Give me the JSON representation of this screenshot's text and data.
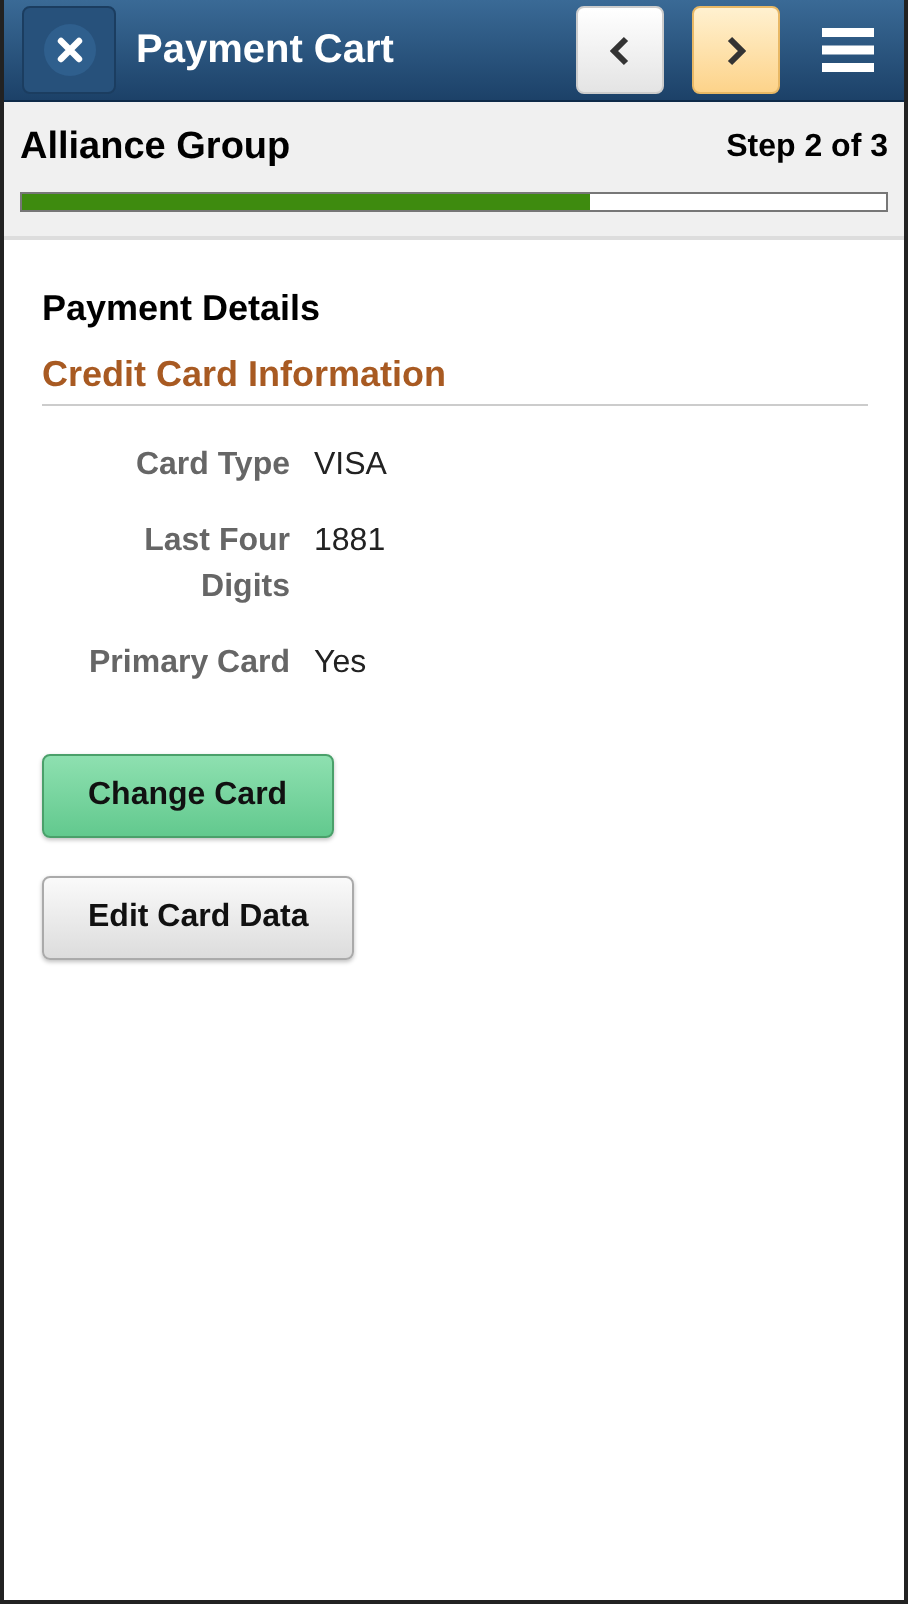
{
  "header": {
    "title": "Payment Cart",
    "nav_buttons": [
      {
        "kind": "previous",
        "highlighted": false
      },
      {
        "kind": "next",
        "highlighted": true
      }
    ]
  },
  "progress": {
    "name": "Alliance Group",
    "step": "Step 2 of 3",
    "level": 0.657
  },
  "section": {
    "title": "Payment Details",
    "group_title": "Credit Card Information",
    "fields": [
      {
        "label": "Card Type",
        "value": "VISA"
      },
      {
        "label": "Last Four Digits",
        "value": "1881"
      },
      {
        "label": "Primary Card",
        "value": "Yes"
      }
    ]
  },
  "buttons": [
    {
      "label": "Change Card",
      "kind": "primary"
    },
    {
      "label": "Edit Card Data",
      "kind": "default"
    }
  ]
}
